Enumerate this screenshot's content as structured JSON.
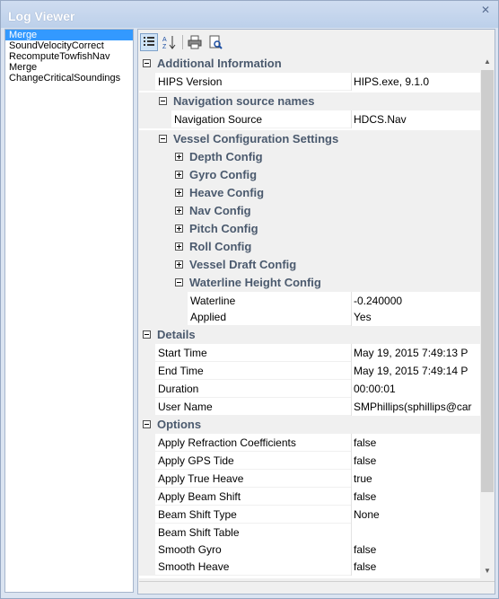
{
  "window": {
    "title": "Log Viewer",
    "close_glyph": "✕"
  },
  "log_list": {
    "items": [
      {
        "label": "Merge",
        "selected": true
      },
      {
        "label": "SoundVelocityCorrect",
        "selected": false
      },
      {
        "label": "RecomputeTowfishNav",
        "selected": false
      },
      {
        "label": "Merge",
        "selected": false
      },
      {
        "label": "ChangeCriticalSoundings",
        "selected": false
      }
    ]
  },
  "toolbar": {
    "buttons": [
      {
        "icon": "categorized-icon",
        "active": true
      },
      {
        "icon": "alphabetical-sort-icon",
        "active": false
      },
      {
        "icon": "print-icon",
        "active": false
      },
      {
        "icon": "print-preview-icon",
        "active": false
      }
    ]
  },
  "grid": {
    "rows": [
      {
        "type": "category",
        "label": "Additional Information",
        "expander": "minus",
        "level": 0
      },
      {
        "type": "property",
        "label": "HIPS Version",
        "value": "HIPS.exe, 9.1.0",
        "level": 0
      },
      {
        "type": "category",
        "label": "Navigation source names",
        "expander": "minus",
        "level": 1
      },
      {
        "type": "property",
        "label": "Navigation Source",
        "value": "HDCS.Nav",
        "level": 1
      },
      {
        "type": "category",
        "label": "Vessel Configuration Settings",
        "expander": "minus",
        "level": 1
      },
      {
        "type": "category",
        "label": "Depth Config",
        "expander": "plus",
        "level": 2
      },
      {
        "type": "category",
        "label": "Gyro Config",
        "expander": "plus",
        "level": 2
      },
      {
        "type": "category",
        "label": "Heave Config",
        "expander": "plus",
        "level": 2
      },
      {
        "type": "category",
        "label": "Nav Config",
        "expander": "plus",
        "level": 2
      },
      {
        "type": "category",
        "label": "Pitch Config",
        "expander": "plus",
        "level": 2
      },
      {
        "type": "category",
        "label": "Roll Config",
        "expander": "plus",
        "level": 2
      },
      {
        "type": "category",
        "label": "Vessel Draft Config",
        "expander": "plus",
        "level": 2
      },
      {
        "type": "category",
        "label": "Waterline Height Config",
        "expander": "minus",
        "level": 2
      },
      {
        "type": "property",
        "label": "Waterline",
        "value": "-0.240000",
        "level": 2
      },
      {
        "type": "property",
        "label": "Applied",
        "value": "Yes",
        "level": 2
      },
      {
        "type": "category",
        "label": "Details",
        "expander": "minus",
        "level": 0
      },
      {
        "type": "property",
        "label": "Start Time",
        "value": "May 19, 2015 7:49:13 P",
        "level": 0
      },
      {
        "type": "property",
        "label": "End Time",
        "value": "May 19, 2015 7:49:14 P",
        "level": 0
      },
      {
        "type": "property",
        "label": "Duration",
        "value": "00:00:01",
        "level": 0
      },
      {
        "type": "property",
        "label": "User Name",
        "value": "SMPhillips(sphillips@car",
        "level": 0
      },
      {
        "type": "category",
        "label": "Options",
        "expander": "minus",
        "level": 0
      },
      {
        "type": "property",
        "label": "Apply Refraction Coefficients",
        "value": "false",
        "level": 0
      },
      {
        "type": "property",
        "label": "Apply GPS Tide",
        "value": "false",
        "level": 0
      },
      {
        "type": "property",
        "label": "Apply True Heave",
        "value": "true",
        "level": 0
      },
      {
        "type": "property",
        "label": "Apply Beam Shift",
        "value": "false",
        "level": 0
      },
      {
        "type": "property",
        "label": "Beam Shift Type",
        "value": "None",
        "level": 0
      },
      {
        "type": "property",
        "label": "Beam Shift Table",
        "value": "",
        "level": 0
      },
      {
        "type": "property",
        "label": "Smooth Gyro",
        "value": "false",
        "level": 0
      },
      {
        "type": "property",
        "label": "Smooth Heave",
        "value": "false",
        "level": 0
      }
    ]
  },
  "colors": {
    "selection": "#3399ff",
    "category_text": "#4b5a6e",
    "window_frame": "#dbe4f1"
  }
}
